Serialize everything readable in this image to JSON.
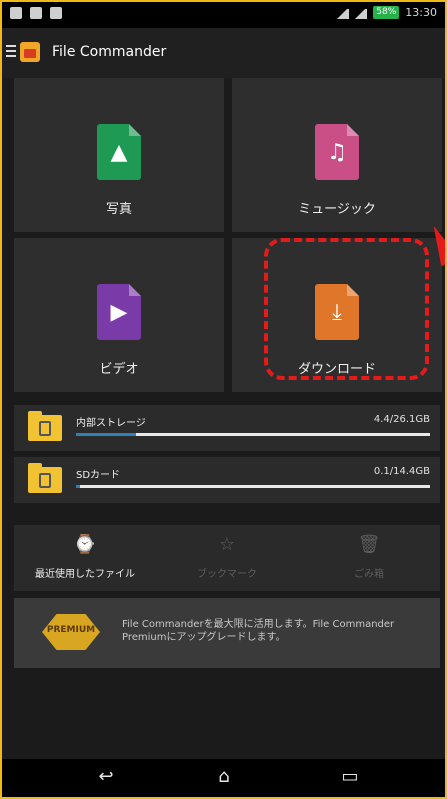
{
  "status_bar": {
    "battery": "58%",
    "time": "13:30"
  },
  "app_bar": {
    "title": "File Commander"
  },
  "tiles": [
    {
      "label": "写真",
      "icon": "image-file-icon",
      "color": "#1f9a55"
    },
    {
      "label": "ミュージック",
      "icon": "music-file-icon",
      "color": "#c94f86"
    },
    {
      "label": "ビデオ",
      "icon": "video-file-icon",
      "color": "#7a3aa8"
    },
    {
      "label": "ダウンロード",
      "icon": "download-file-icon",
      "color": "#e0762a"
    }
  ],
  "storage": [
    {
      "name": "内部ストレージ",
      "size": "4.4/26.1GB",
      "used_fraction": 0.17
    },
    {
      "name": "SDカード",
      "size": "0.1/14.4GB",
      "used_fraction": 0.01
    }
  ],
  "quick_actions": [
    {
      "label": "最近使用したファイル",
      "icon": "recent-files-icon",
      "enabled": true
    },
    {
      "label": "ブックマーク",
      "icon": "star-icon",
      "enabled": false
    },
    {
      "label": "ごみ箱",
      "icon": "trash-icon",
      "enabled": false
    }
  ],
  "premium": {
    "badge": "PREMIUM",
    "text": "File Commanderを最大限に活用します。File Commander Premiumにアップグレードします。"
  },
  "colors": {
    "highlight": "#e41b1b",
    "frame": "#f2b818",
    "progress": "#2f7fb8"
  }
}
